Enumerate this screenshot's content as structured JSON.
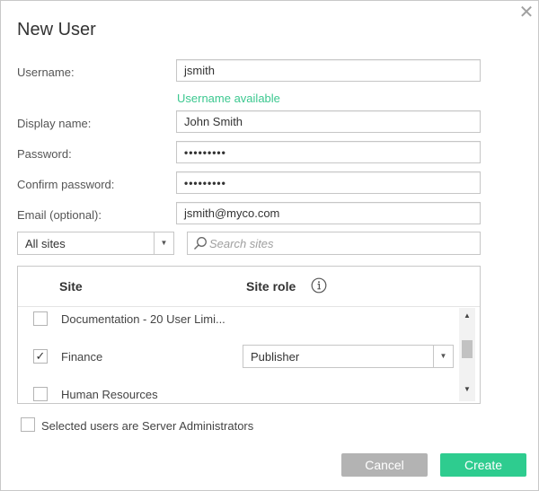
{
  "dialog": {
    "title": "New User",
    "close_icon": "close-icon"
  },
  "form": {
    "username": {
      "label": "Username:",
      "value": "jsmith",
      "status": "Username available",
      "status_color": "#3cc890"
    },
    "display_name": {
      "label": "Display name:",
      "value": "John Smith"
    },
    "password": {
      "label": "Password:",
      "value": "•••••••••"
    },
    "confirm_password": {
      "label": "Confirm password:",
      "value": "•••••••••"
    },
    "email": {
      "label": "Email (optional):",
      "value": "jsmith@myco.com"
    }
  },
  "filter": {
    "sites_select": {
      "value": "All sites",
      "icon": "chevron-down-icon"
    },
    "search": {
      "placeholder": "Search sites",
      "icon": "search-icon"
    }
  },
  "sites_table": {
    "columns": [
      "Site",
      "Site role"
    ],
    "info_icon": "info-icon",
    "rows": [
      {
        "name": "Documentation - 20 User Limi...",
        "checked": false,
        "role": null
      },
      {
        "name": "Finance",
        "checked": true,
        "role": "Publisher"
      },
      {
        "name": "Human Resources",
        "checked": false,
        "role": null
      }
    ]
  },
  "admin_checkbox": {
    "label": "Selected users are Server Administrators",
    "checked": false
  },
  "buttons": {
    "cancel": "Cancel",
    "create": "Create",
    "create_color": "#2ecc8f",
    "cancel_color": "#b3b3b3"
  },
  "glyphs": {
    "close": "✕",
    "check": "✓",
    "down": "▼",
    "up": "▲"
  }
}
